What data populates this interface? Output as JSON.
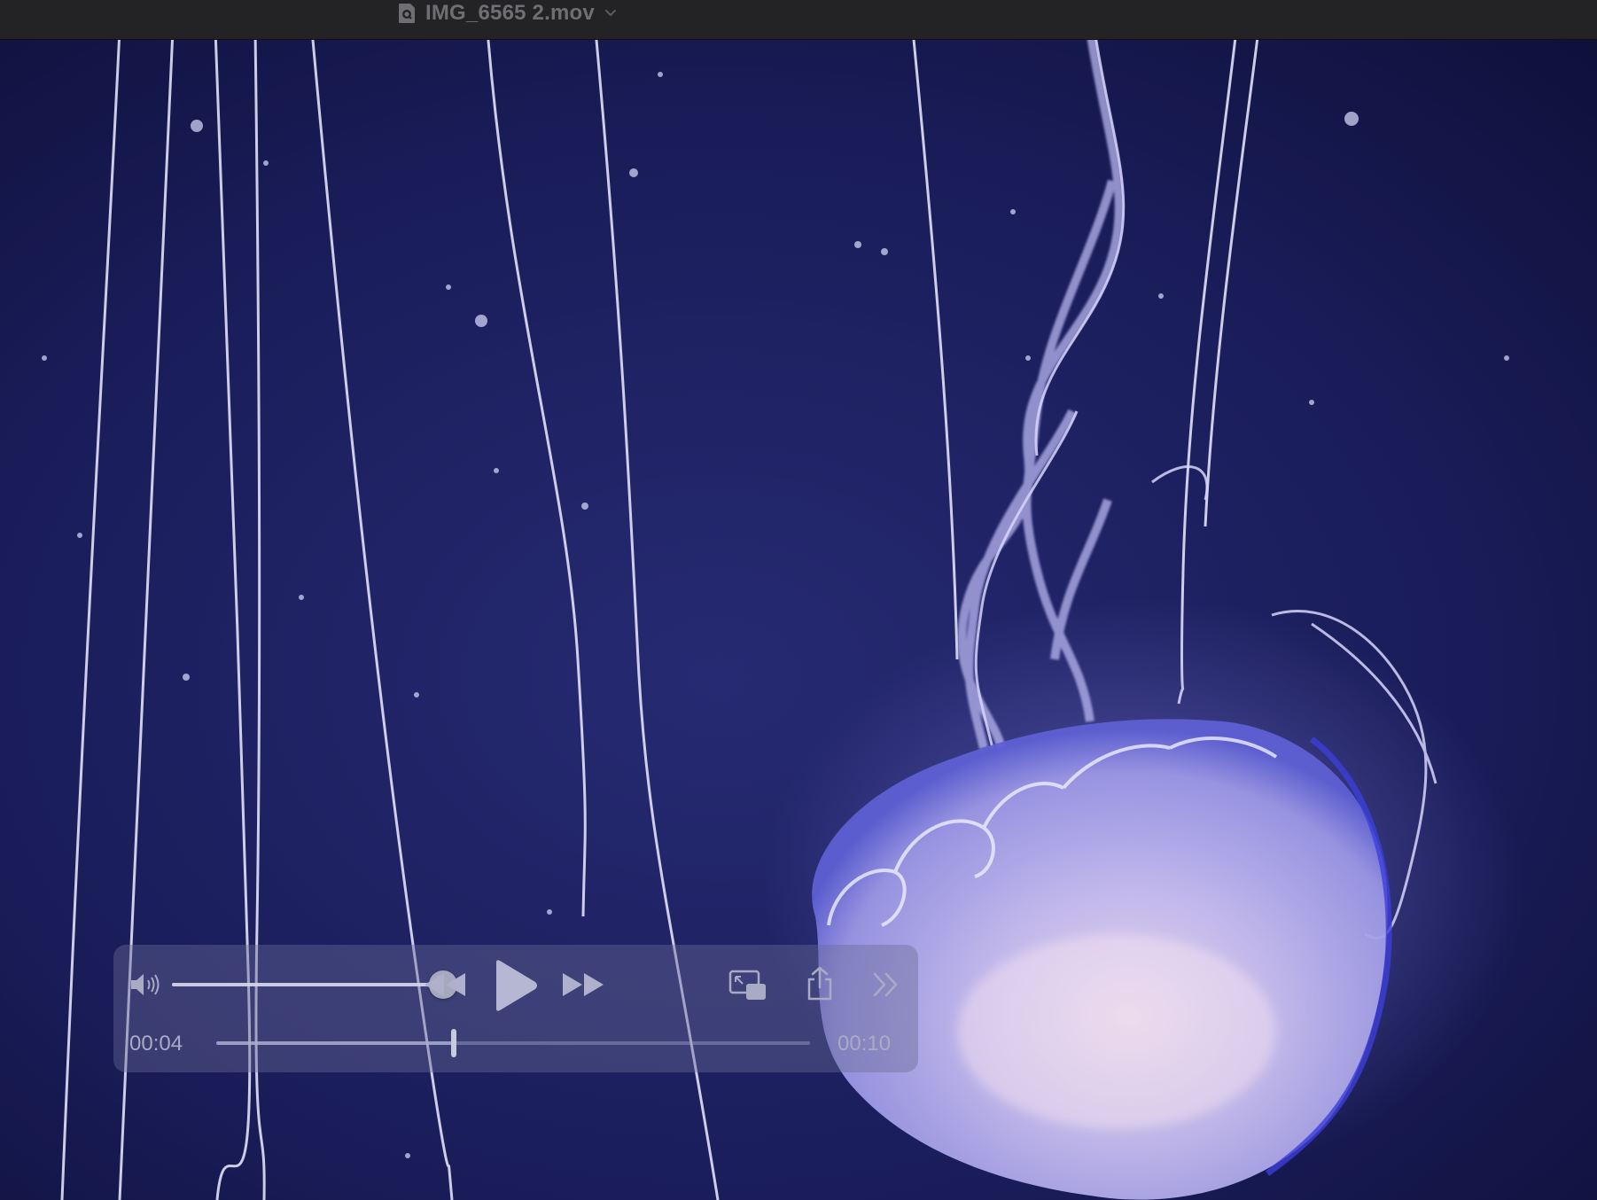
{
  "window": {
    "title": "IMG_6565 2.mov",
    "title_icon": "quicktime-doc-icon",
    "title_menu_icon": "chevron-down-icon"
  },
  "controls": {
    "volume": {
      "icon": "speaker-icon",
      "level": 1.0
    },
    "transport": {
      "rewind_icon": "rewind-icon",
      "play_icon": "play-icon",
      "fast_forward_icon": "fast-forward-icon"
    },
    "actions": {
      "pip_icon": "picture-in-picture-icon",
      "share_icon": "share-icon",
      "more_icon": "double-chevron-right-icon"
    },
    "time_elapsed": "00:04",
    "time_total": "00:10",
    "progress": 0.4
  },
  "colors": {
    "titlebar": "#232326",
    "hud": "#696c96",
    "water_deep": "#0a0c2e",
    "water_mid": "#2a2e78",
    "jellyfish": "#cbc4f0"
  }
}
